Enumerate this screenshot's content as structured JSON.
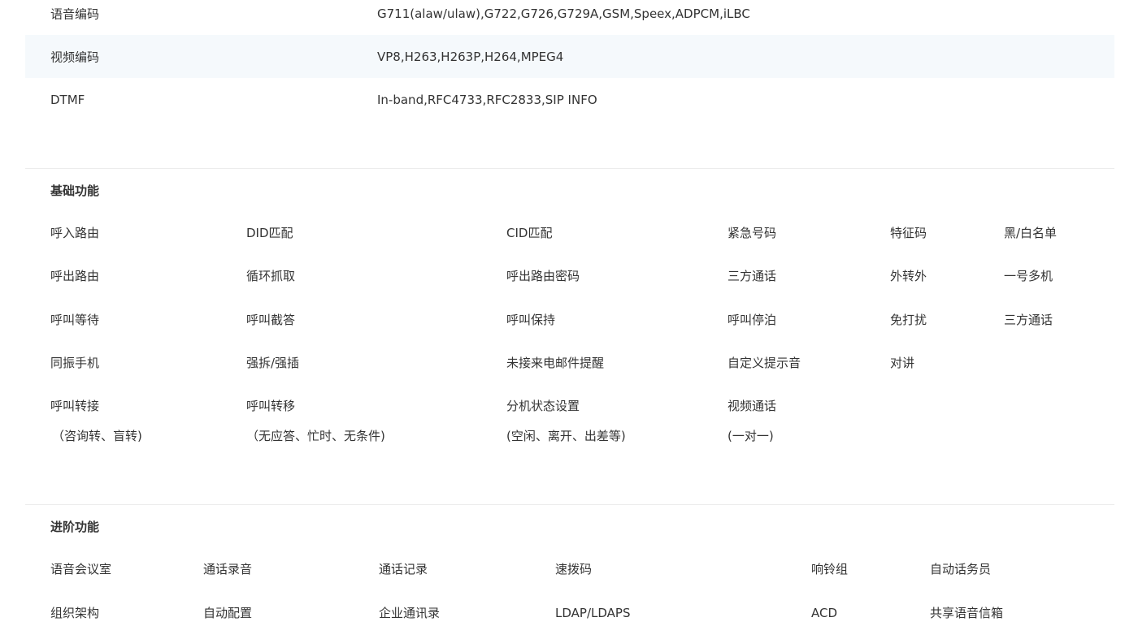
{
  "specs": [
    {
      "label": "语音编码",
      "value": "G711(alaw/ulaw),G722,G726,G729A,GSM,Speex,ADPCM,iLBC"
    },
    {
      "label": "视频编码",
      "value": "VP8,H263,H263P,H264,MPEG4"
    },
    {
      "label": "DTMF",
      "value": "In-band,RFC4733,RFC2833,SIP INFO"
    }
  ],
  "basic": {
    "title": "基础功能",
    "rows": [
      [
        "呼入路由",
        "DID匹配",
        "CID匹配",
        "紧急号码",
        "特征码",
        "黑/白名单"
      ],
      [
        "呼出路由",
        "循环抓取",
        "呼出路由密码",
        "三方通话",
        "外转外",
        "一号多机"
      ],
      [
        "呼叫等待",
        "呼叫截答",
        "呼叫保持",
        "呼叫停泊",
        "免打扰",
        "三方通话"
      ],
      [
        "同振手机",
        "强拆/强插",
        "未接来电邮件提醒",
        "自定义提示音",
        "对讲"
      ],
      [
        "呼叫转接",
        "呼叫转移",
        "分机状态设置",
        "视频通话"
      ]
    ],
    "notes": [
      "（咨询转、盲转)",
      "（无应答、忙时、无条件)",
      "(空闲、离开、出差等)",
      "(一对一)"
    ]
  },
  "advanced": {
    "title": "进阶功能",
    "rows": [
      [
        "语音会议室",
        "通话录音",
        "通话记录",
        "速拨码",
        "响铃组",
        "自动话务员"
      ],
      [
        "组织架构",
        "自动配置",
        "企业通讯录",
        "LDAP/LDAPS",
        "ACD",
        "共享语音信箱"
      ]
    ]
  }
}
